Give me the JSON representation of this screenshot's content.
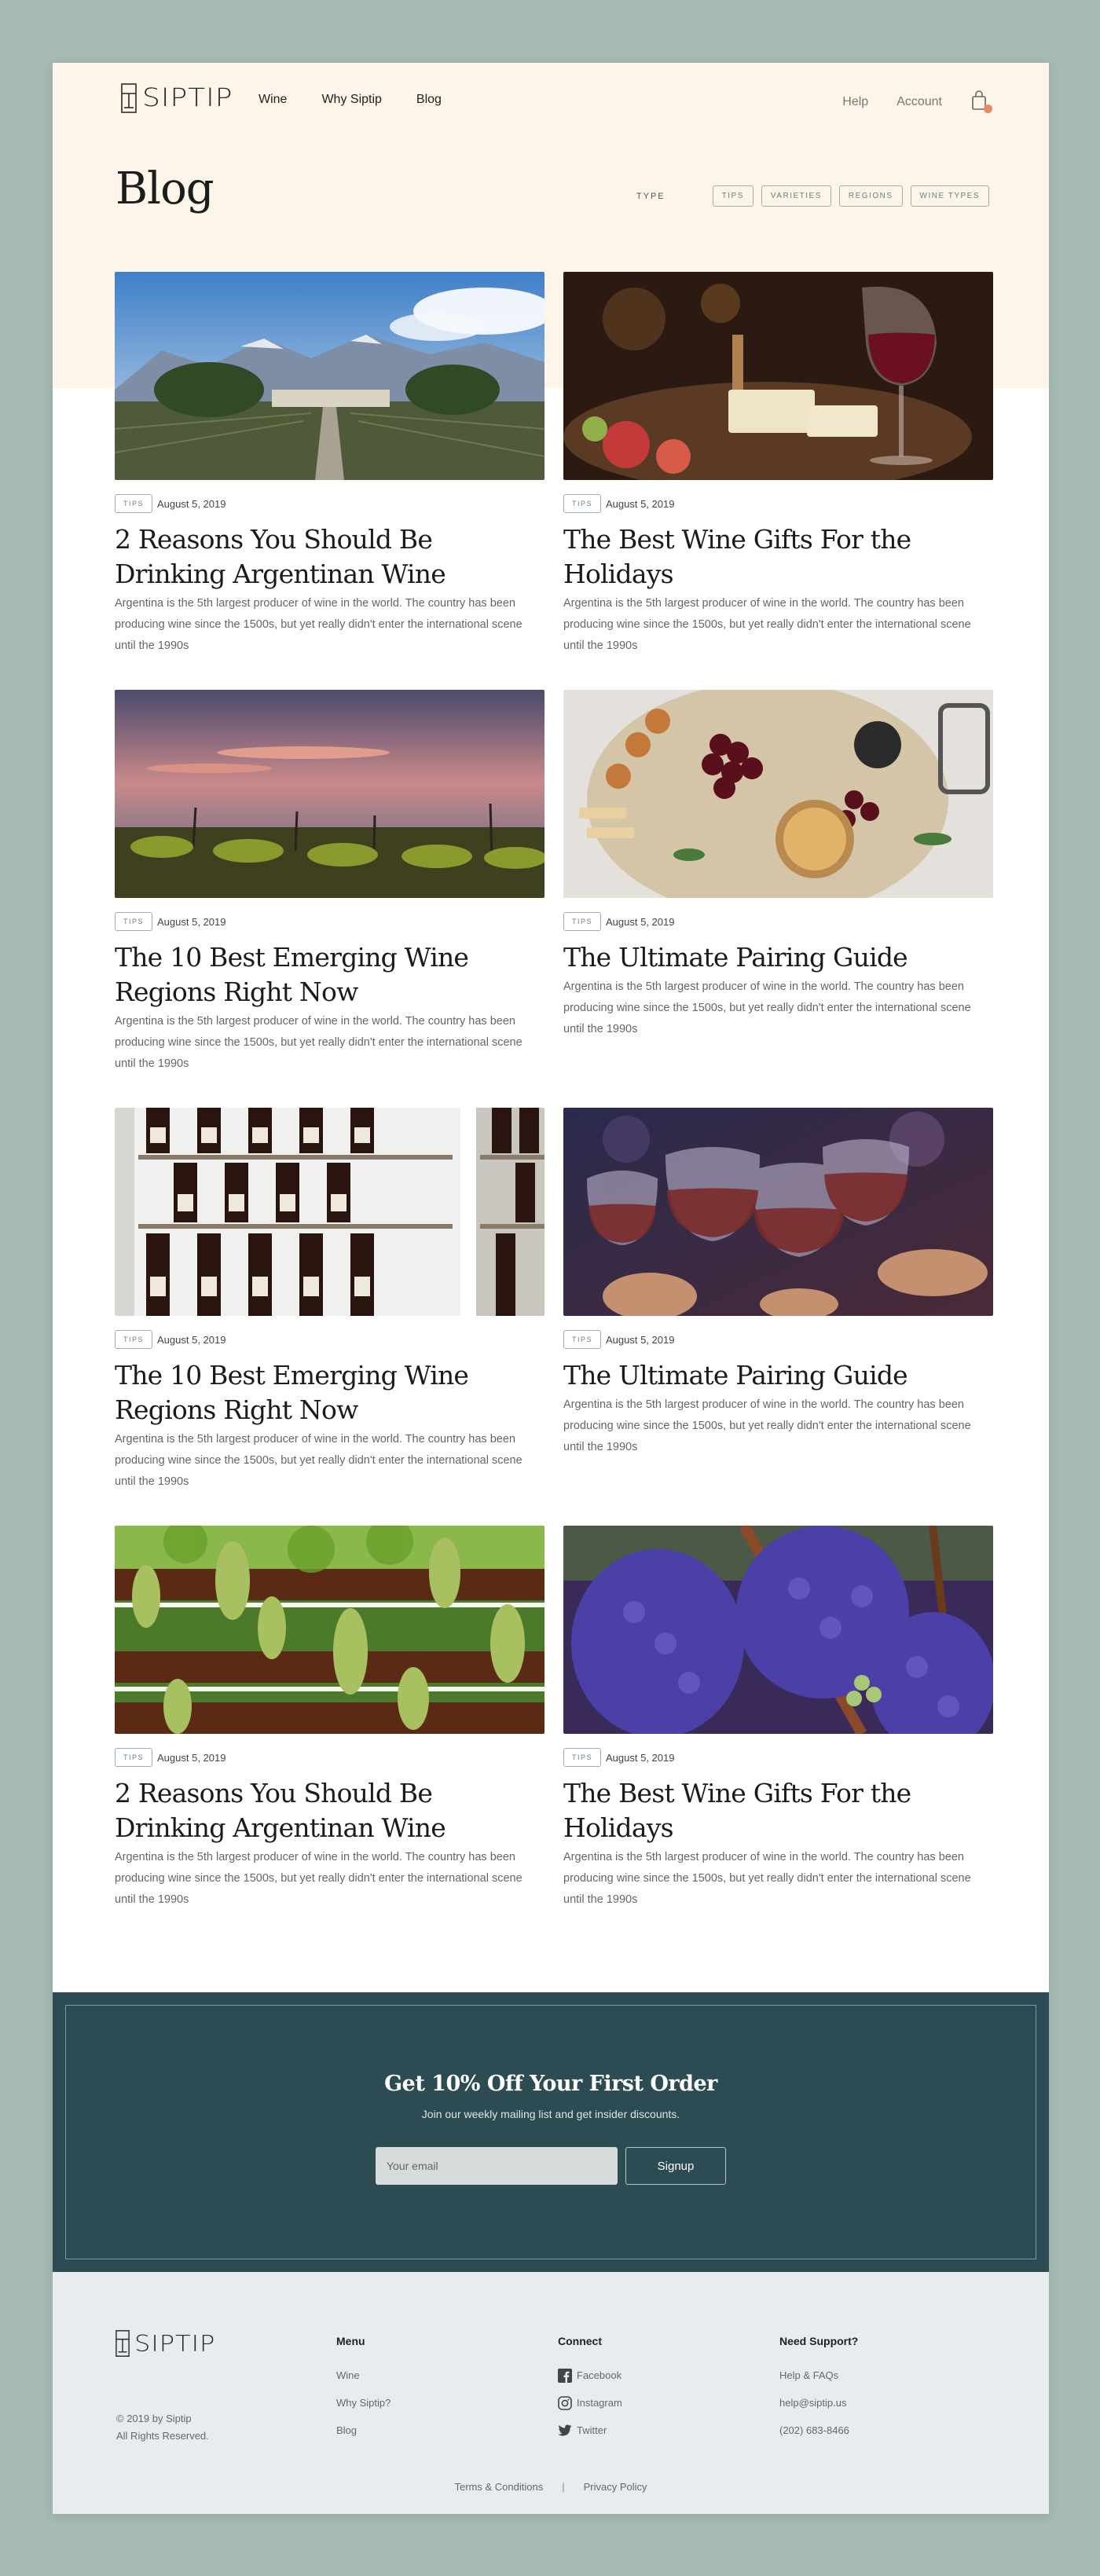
{
  "brand": {
    "name": "SIPTIP"
  },
  "nav": {
    "left": [
      "Wine",
      "Why Siptip",
      "Blog"
    ],
    "right": [
      "Help",
      "Account"
    ]
  },
  "page": {
    "title": "Blog"
  },
  "filter": {
    "label": "TYPE",
    "chips": [
      "TIPS",
      "VARIETIES",
      "REGIONS",
      "WINE TYPES"
    ]
  },
  "posts": [
    {
      "tag": "TIPS",
      "date": "August 5, 2019",
      "title": "2 Reasons You Should Be Drinking Argentinan Wine",
      "excerpt": "Argentina is the 5th largest producer of wine in the world. The country has been producing wine since the 1500s, but yet really didn't enter the international scene until the 1990s",
      "image": "mountain-vineyard-photo"
    },
    {
      "tag": "TIPS",
      "date": "August 5, 2019",
      "title": "The Best Wine Gifts For the Holidays",
      "excerpt": "Argentina is the 5th largest producer of wine in the world. The country has been producing wine since the 1500s, but yet really didn't enter the international scene until the 1990s",
      "image": "wine-glass-cheese-photo"
    },
    {
      "tag": "TIPS",
      "date": "August 5, 2019",
      "title": "The 10 Best Emerging Wine Regions Right Now",
      "excerpt": "Argentina is the 5th largest producer of wine in the world. The country has been producing wine since the 1500s, but yet really didn't enter the international scene until the 1990s",
      "image": "sunset-vineyard-photo"
    },
    {
      "tag": "TIPS",
      "date": "August 5, 2019",
      "title": "The Ultimate Pairing Guide",
      "excerpt": "Argentina is the 5th largest producer of wine in the world. The country has been producing wine since the 1500s, but yet really didn't enter the international scene until the 1990s",
      "image": "charcuterie-board-photo"
    },
    {
      "tag": "TIPS",
      "date": "August 5, 2019",
      "title": "The 10 Best Emerging Wine Regions Right Now",
      "excerpt": "Argentina is the 5th largest producer of wine in the world. The country has been producing wine since the 1500s, but yet really didn't enter the international scene until the 1990s",
      "image": "wine-bottle-shelf-photo"
    },
    {
      "tag": "TIPS",
      "date": "August 5, 2019",
      "title": "The Ultimate Pairing Guide",
      "excerpt": "Argentina is the 5th largest producer of wine in the world. The country has been producing wine since the 1500s, but yet really didn't enter the international scene until the 1990s",
      "image": "wine-toast-photo"
    },
    {
      "tag": "TIPS",
      "date": "August 5, 2019",
      "title": "2 Reasons You Should Be Drinking Argentinan Wine",
      "excerpt": "Argentina is the 5th largest producer of wine in the world. The country has been producing wine since the 1500s, but yet really didn't enter the international scene until the 1990s",
      "image": "grape-pergola-photo"
    },
    {
      "tag": "TIPS",
      "date": "August 5, 2019",
      "title": "The Best Wine Gifts For the Holidays",
      "excerpt": "Argentina is the 5th largest producer of wine in the world. The country has been producing wine since the 1500s, but yet really didn't enter the international scene until the 1990s",
      "image": "purple-grapes-photo"
    }
  ],
  "newsletter": {
    "title": "Get 10% Off Your First Order",
    "subtitle": "Join our weekly mailing list and get insider discounts.",
    "placeholder": "Your email",
    "button": "Signup"
  },
  "footer": {
    "copyright": [
      "© 2019 by Siptip",
      "All Rights Reserved."
    ],
    "menu": {
      "heading": "Menu",
      "items": [
        "Wine",
        "Why Siptip?",
        "Blog"
      ]
    },
    "connect": {
      "heading": "Connect",
      "items": [
        "Facebook",
        "Instagram",
        "Twitter"
      ]
    },
    "support": {
      "heading": "Need Support?",
      "items": [
        "Help & FAQs",
        "help@siptip.us",
        "(202) 683-8466"
      ]
    },
    "legal": [
      "Terms & Conditions",
      "|",
      "Privacy Policy"
    ]
  },
  "colors": {
    "outer_bg": "#a5bbb4",
    "hero_bg": "#fdf4ea",
    "newsletter_bg": "#2c4b52",
    "footer_bg": "#e8ecee",
    "accent": "#e88a63"
  }
}
